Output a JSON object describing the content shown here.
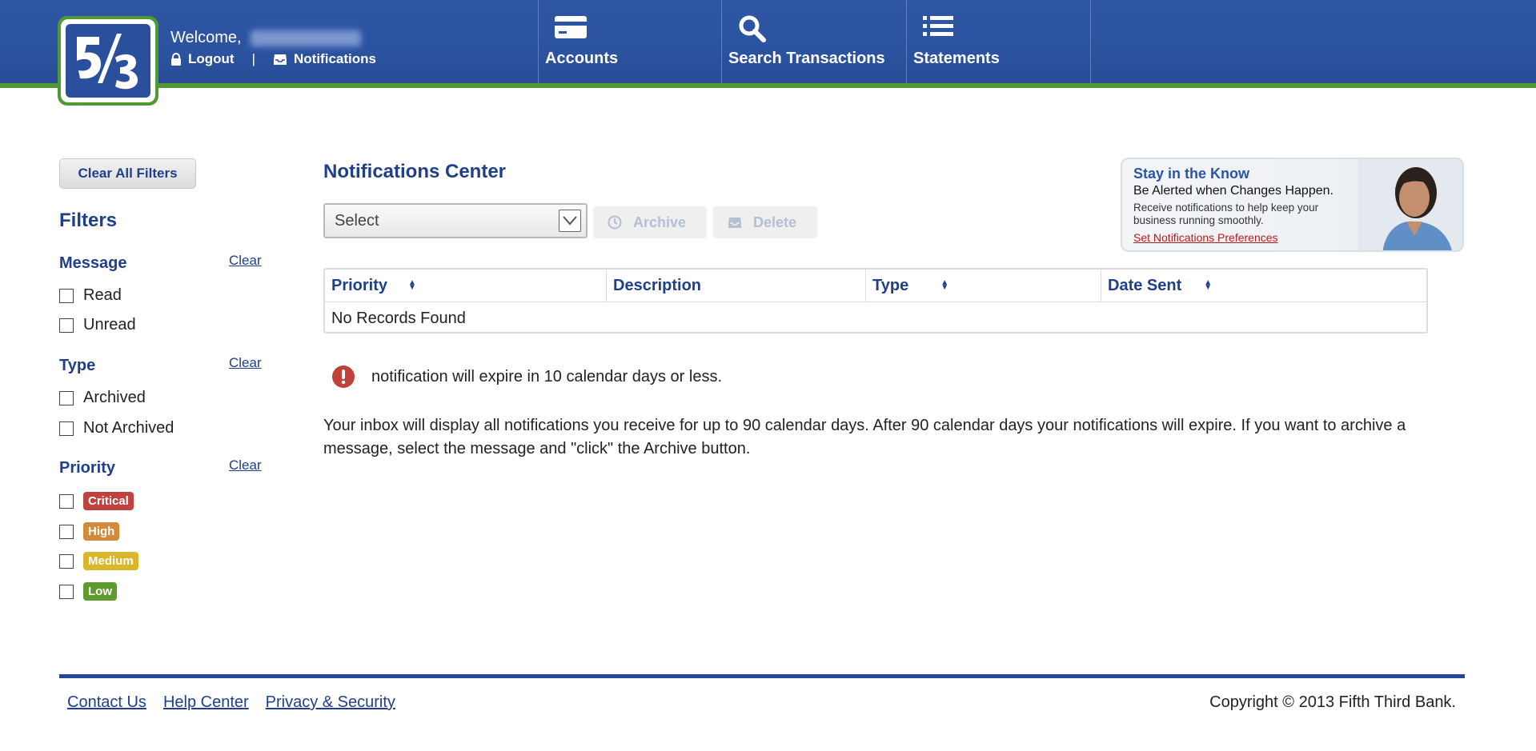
{
  "header": {
    "welcome_label": "Welcome,",
    "logout_label": "Logout",
    "separator": "|",
    "notifications_label": "Notifications",
    "nav": [
      {
        "label": "Accounts",
        "icon": "card-icon"
      },
      {
        "label": "Search Transactions",
        "icon": "search-icon"
      },
      {
        "label": "Statements",
        "icon": "list-icon"
      }
    ]
  },
  "sidebar": {
    "clear_all_label": "Clear All Filters",
    "filters_title": "Filters",
    "clear_label": "Clear",
    "groups": [
      {
        "title": "Message",
        "options": [
          "Read",
          "Unread"
        ]
      },
      {
        "title": "Type",
        "options": [
          "Archived",
          "Not Archived"
        ]
      },
      {
        "title": "Priority",
        "options": [
          "Critical",
          "High",
          "Medium",
          "Low"
        ]
      }
    ]
  },
  "main": {
    "title": "Notifications Center",
    "select_value": "Select",
    "archive_label": "Archive",
    "delete_label": "Delete",
    "table": {
      "columns": [
        "Priority",
        "Description",
        "Type",
        "Date Sent"
      ],
      "empty_text": "No Records Found"
    },
    "expire_text": "notification will expire in 10 calendar days or less.",
    "info_text": "Your inbox will display all notifications you receive for up to 90 calendar days. After 90 calendar days your notifications will expire. If you want to archive a message, select the message and \"click\" the Archive button."
  },
  "promo": {
    "title": "Stay in the Know",
    "subtitle": "Be Alerted when Changes Happen.",
    "body": "Receive notifications to help keep your business running smoothly.",
    "link": "Set Notifications Preferences"
  },
  "footer": {
    "links": [
      "Contact Us",
      "Help Center",
      "Privacy & Security"
    ],
    "copyright": "Copyright © 2013 Fifth Third Bank."
  },
  "colors": {
    "header_blue": "#2c53a0",
    "accent_green": "#4f9a34",
    "link_blue": "#1f3f8a",
    "critical": "#c0423f",
    "high": "#d18a3a",
    "medium": "#d8b82a",
    "low": "#5e9a2e"
  }
}
